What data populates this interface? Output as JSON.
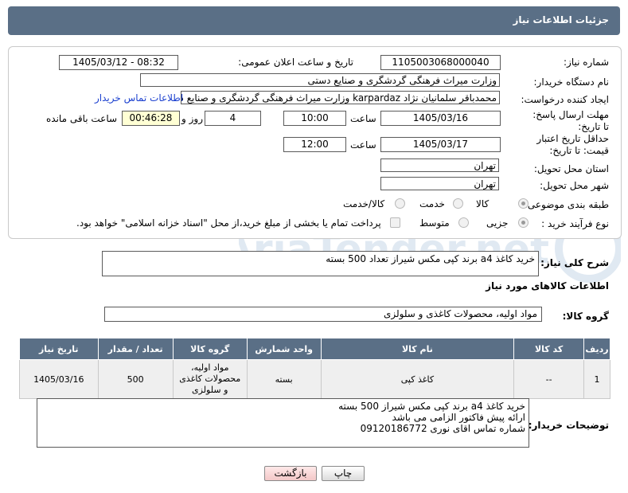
{
  "header": {
    "title": "جزئیات اطلاعات نیاز"
  },
  "form": {
    "need_number": {
      "label": "شماره نیاز:",
      "value": "1105003068000040"
    },
    "announce_datetime": {
      "label": "تاریخ و ساعت اعلان عمومی:",
      "value": "1405/03/12 - 08:32"
    },
    "buyer_org": {
      "label": "نام دستگاه خریدار:",
      "value": "وزارت میراث فرهنگی  گردشگری و صنایع دستی"
    },
    "requester": {
      "label": "ایجاد کننده درخواست:",
      "value": "محمدباقر سلمانیان نژاد karpardaz وزارت میراث فرهنگی  گردشگری و صنایع دس",
      "contact_link": "اطلاعات تماس خریدار"
    },
    "reply_deadline": {
      "label": "مهلت ارسال پاسخ: تا تاریخ:",
      "date": "1405/03/16",
      "time_label": "ساعت",
      "time": "10:00",
      "days": "4",
      "days_label": "روز و",
      "remaining": "00:46:28",
      "remaining_label": "ساعت باقی مانده"
    },
    "price_validity": {
      "label": "حداقل تاریخ اعتبار قیمت: تا تاریخ:",
      "date": "1405/03/17",
      "time_label": "ساعت",
      "time": "12:00"
    },
    "delivery_province": {
      "label": "استان محل تحویل:",
      "value": "تهران"
    },
    "delivery_city": {
      "label": "شهر محل تحویل:",
      "value": "تهران"
    },
    "category": {
      "label": "طبقه بندی موضوعی:",
      "options": [
        "کالا",
        "خدمت",
        "کالا/خدمت"
      ],
      "selected": "کالا"
    },
    "purchase_type": {
      "label": "نوع فرآیند خرید :",
      "options": [
        "جزیی",
        "متوسط"
      ],
      "note": "پرداخت تمام یا بخشی از مبلغ خرید،از محل \"اسناد خزانه اسلامی\" خواهد بود."
    }
  },
  "summary": {
    "label": "شرح کلی نیاز:",
    "value": "خرید کاغذ a4 برند کپی مکس شیراز تعداد 500 بسته"
  },
  "goods_info": {
    "title": "اطلاعات کالاهای مورد نیاز"
  },
  "goods_group": {
    "label": "گروه کالا:",
    "value": "مواد اولیه، محصولات کاغذی و سلولزی"
  },
  "table": {
    "headers": [
      "ردیف",
      "کد کالا",
      "نام کالا",
      "واحد شمارش",
      "گروه کالا",
      "تعداد / مقدار",
      "تاریخ نیاز"
    ],
    "rows": [
      {
        "row": "1",
        "code": "--",
        "name": "کاغذ کپی",
        "unit": "بسته",
        "group": "مواد اولیه، محصولات کاغذی و سلولزی",
        "qty": "500",
        "date": "1405/03/16"
      }
    ]
  },
  "buyer_notes": {
    "label": "توضیحات خریدار:",
    "lines": [
      "خرید کاغذ a4 برند کپی مکس شیراز 500 بسته",
      "ارائه پیش فاکتور الزامی می باشد",
      "شماره تماس اقای نوری 09120186772"
    ]
  },
  "buttons": {
    "print": "چاپ",
    "back": "بازگشت"
  },
  "watermark": {
    "text": "AriaTender.net"
  }
}
